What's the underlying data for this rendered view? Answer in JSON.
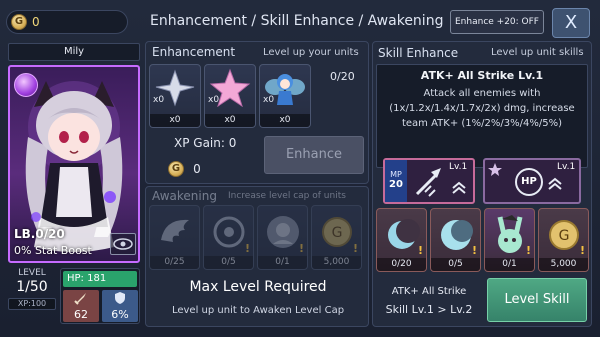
{
  "topbar": {
    "gold_value": "0",
    "title": "Enhancement / Skill Enhance / Awakening",
    "enhance_toggle": "Enhance +20: OFF",
    "close_label": "X"
  },
  "character": {
    "name": "Mily",
    "lb": "LB.0/20",
    "stat_boost": "0% Stat Boost",
    "level_label": "LEVEL",
    "level": "1/50",
    "xp": "XP:100",
    "hp": "HP: 181",
    "atk": "62",
    "def": "6%"
  },
  "enhancement": {
    "title": "Enhancement",
    "subtitle": "Level up your units",
    "progress": "0/20",
    "items": [
      {
        "count": "x0",
        "owned": "x0",
        "icon": "silver-star-icon"
      },
      {
        "count": "x0",
        "owned": "x0",
        "icon": "pink-star-icon"
      },
      {
        "count": "x0",
        "owned": "x0",
        "icon": "fairy-unit-icon"
      }
    ],
    "xp_gain": "XP Gain: 0",
    "gold_cost": "0",
    "button": "Enhance"
  },
  "awakening": {
    "title": "Awakening",
    "subtitle": "Increase level cap of units",
    "items": [
      {
        "count": "0/25",
        "icon": "wing-fragment-icon"
      },
      {
        "count": "0/5",
        "icon": "orb-icon"
      },
      {
        "count": "0/1",
        "icon": "character-shard-icon"
      },
      {
        "count": "5,000",
        "icon": "gold-coin-icon"
      }
    ],
    "max_level_title": "Max Level Required",
    "max_level_desc": "Level up unit to Awaken Level Cap"
  },
  "skill": {
    "title": "Skill Enhance",
    "subtitle": "Level up unit skills",
    "skill_name": "ATK+ All Strike Lv.1",
    "description": "Attack all enemies with (1x/1.2x/1.4x/1.7x/2x) dmg, increase team ATK+ (1%/2%/3%/4%/5%)",
    "skill1_level": "Lv.1",
    "skill1_mp_label": "MP",
    "skill1_mp": "20",
    "skill2_level": "Lv.1",
    "skill2_hp": "HP",
    "items": [
      {
        "count": "0/20",
        "icon": "moon-icon"
      },
      {
        "count": "0/5",
        "icon": "moon-orb-icon"
      },
      {
        "count": "0/1",
        "icon": "bunny-character-icon"
      },
      {
        "count": "5,000",
        "icon": "gold-coin-icon"
      }
    ],
    "footer_name": "ATK+ All Strike",
    "footer_levels": "Skill Lv.1 > Lv.2",
    "button": "Level Skill"
  }
}
